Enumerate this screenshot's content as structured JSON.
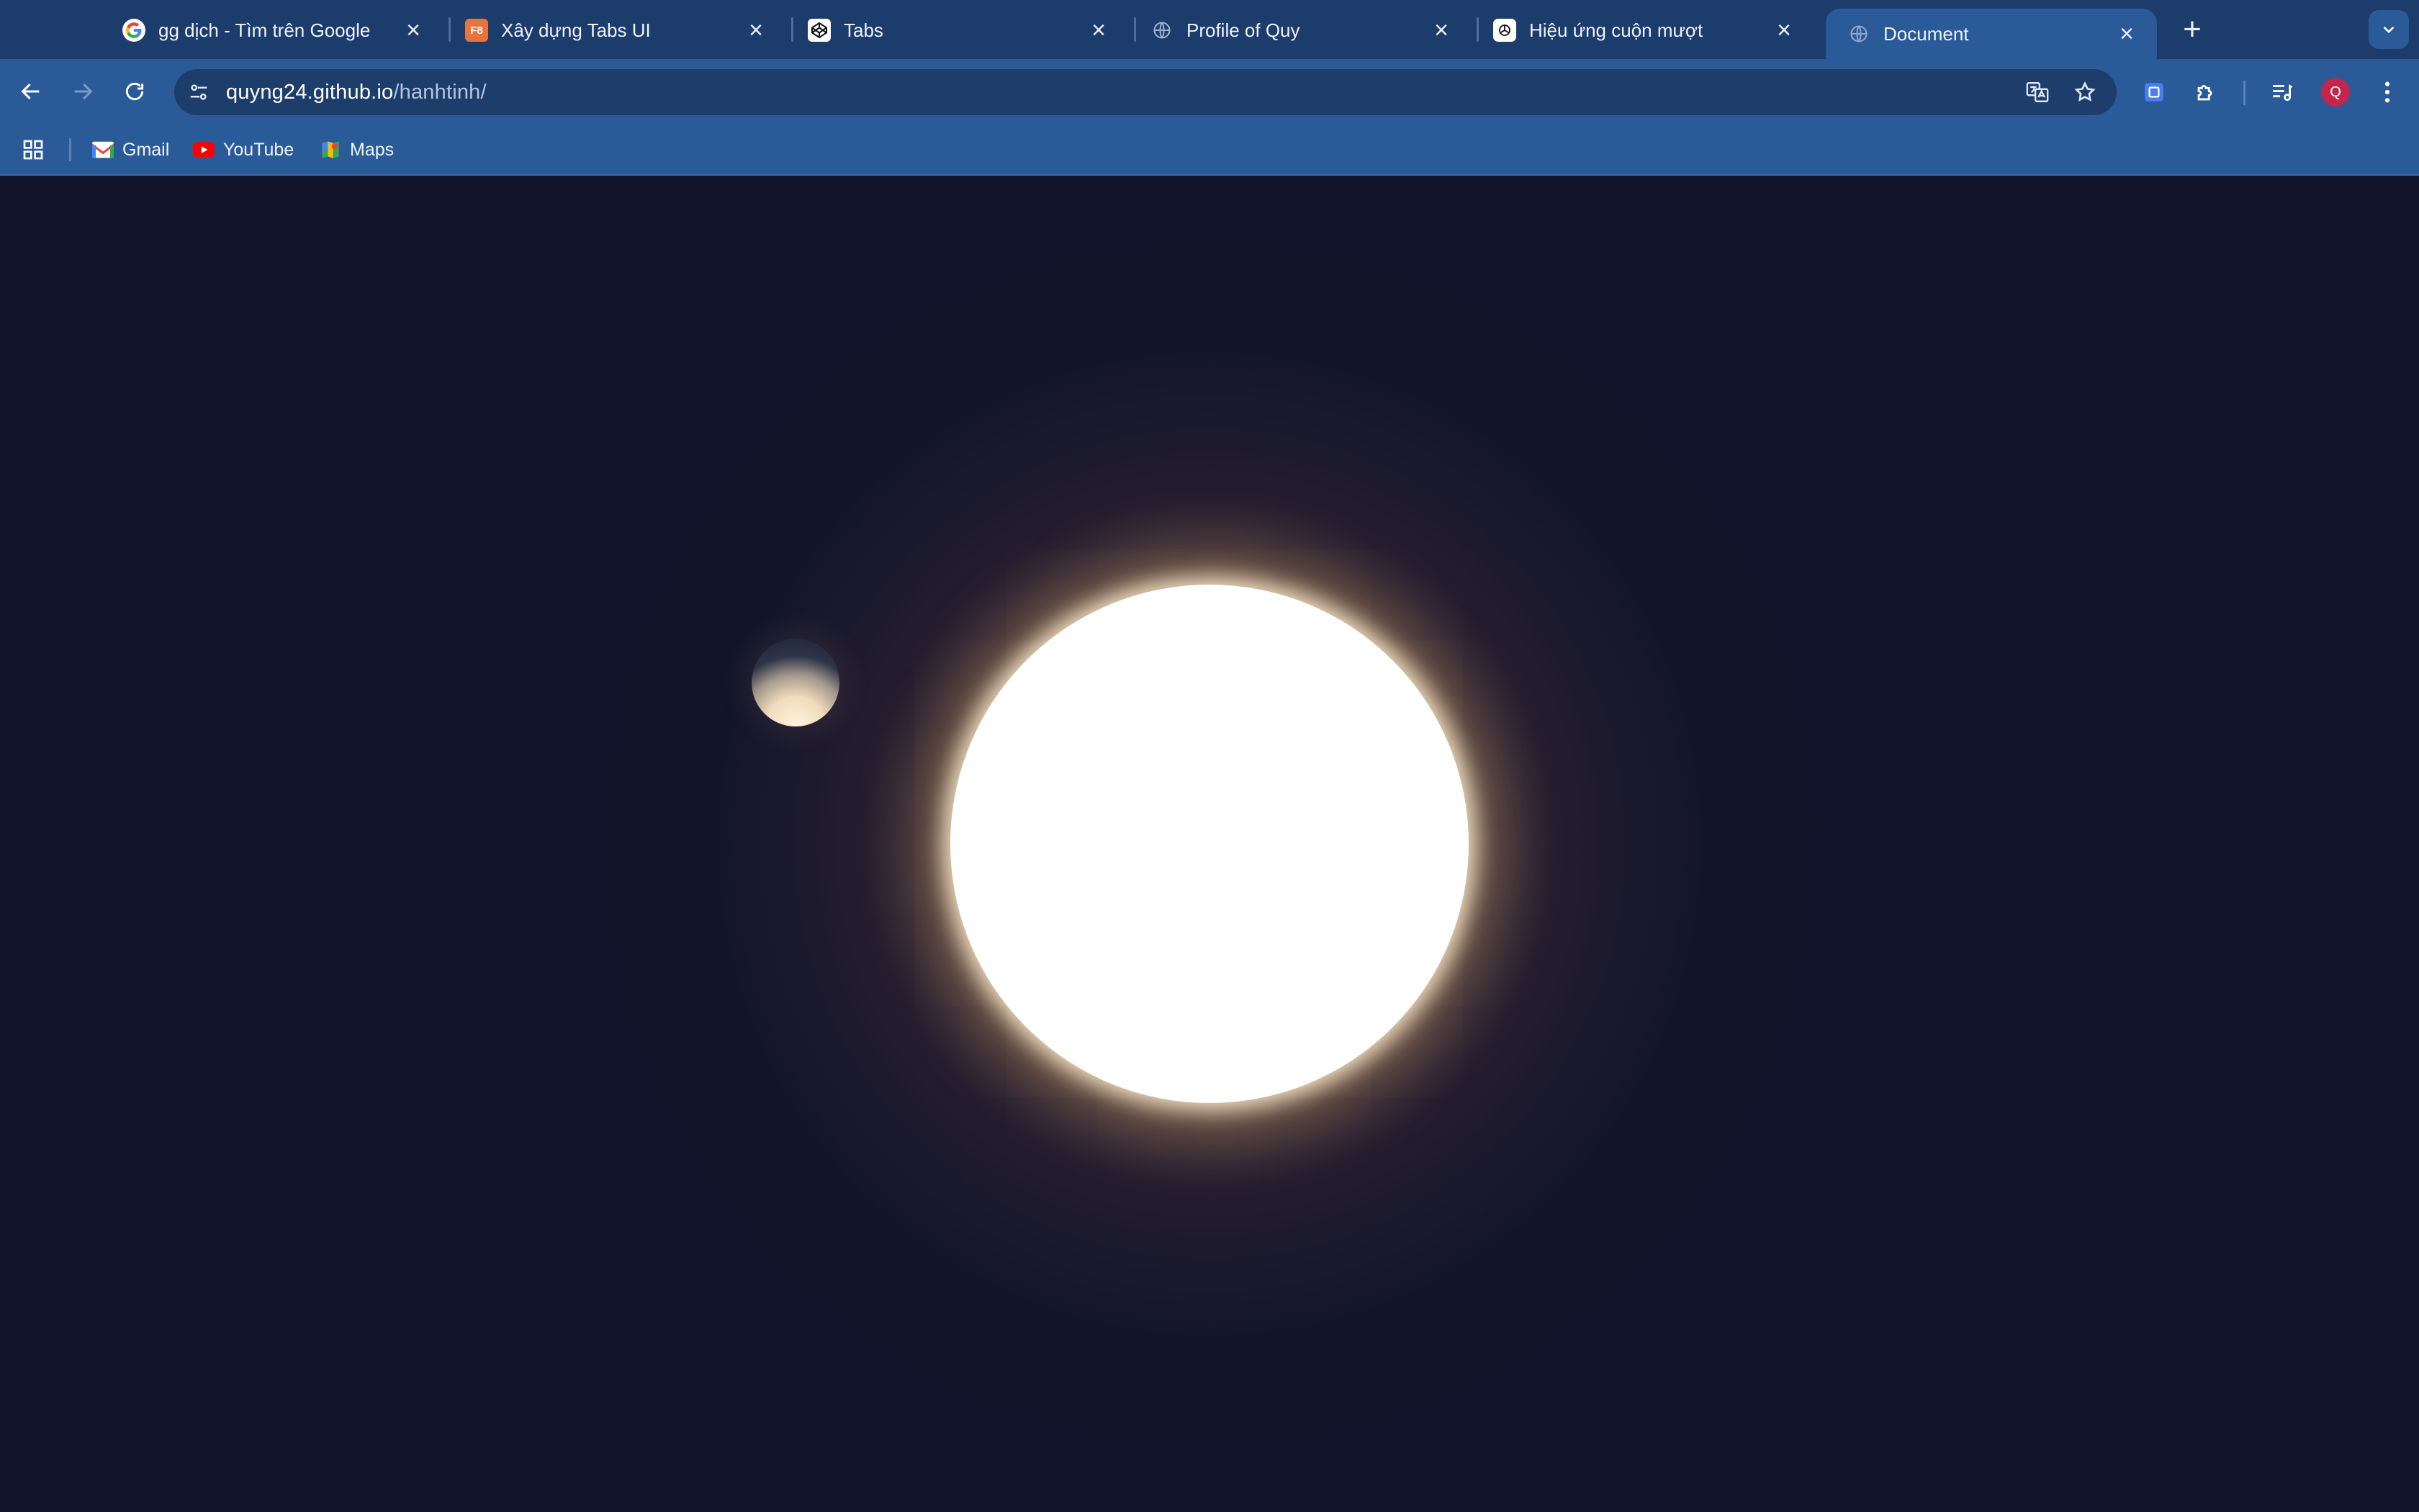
{
  "tabs": [
    {
      "title": "gg dịch - Tìm trên Google",
      "favicon": "google-icon",
      "active": false
    },
    {
      "title": "Xây dựng Tabs UI",
      "favicon": "f8-icon",
      "favicon_text": "F8",
      "active": false
    },
    {
      "title": "Tabs",
      "favicon": "codepen-icon",
      "active": false
    },
    {
      "title": "Profile of Quy",
      "favicon": "globe-icon",
      "active": false
    },
    {
      "title": "Hiệu ứng cuộn mượt",
      "favicon": "openai-icon",
      "active": false
    },
    {
      "title": "Document",
      "favicon": "globe-icon",
      "active": true
    }
  ],
  "address_bar": {
    "host": "quyng24.github.io",
    "path": "/hanhtinh/"
  },
  "bookmarks": [
    {
      "label": "Gmail",
      "icon": "gmail-icon"
    },
    {
      "label": "YouTube",
      "icon": "youtube-icon"
    },
    {
      "label": "Maps",
      "icon": "maps-icon"
    }
  ],
  "profile": {
    "initial": "Q",
    "color": "#c2264d"
  },
  "colors": {
    "tabstrip": "#1c3c6b",
    "toolbar": "#2a5b98",
    "page_background": "#11142a",
    "sun": "#ffffff"
  }
}
